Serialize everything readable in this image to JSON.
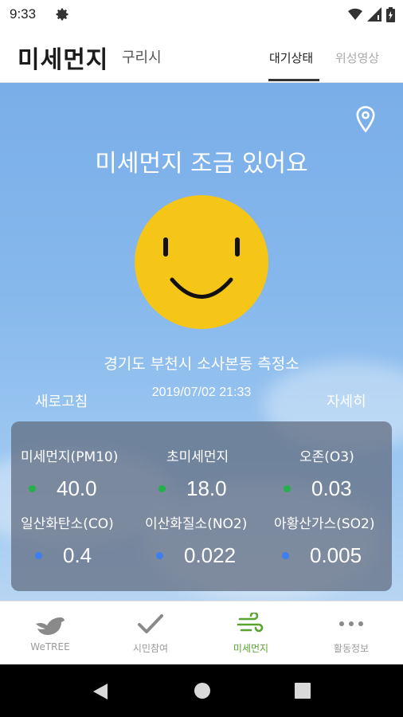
{
  "status_bar": {
    "time": "9:33"
  },
  "header": {
    "logo": "미세먼지",
    "city": "구리시",
    "tabs": [
      {
        "label": "대기상태",
        "active": true
      },
      {
        "label": "위성영상",
        "active": false
      }
    ]
  },
  "main": {
    "headline": "미세먼지 조금 있어요",
    "station": "경기도 부천시 소사본동 측정소",
    "refresh_label": "새로고침",
    "datetime": "2019/07/02 21:33",
    "detail_label": "자세히",
    "measurements": [
      {
        "label": "미세먼지(PM10)",
        "value": "40.0",
        "status_color": "#22b14c"
      },
      {
        "label": "초미세먼지",
        "value": "18.0",
        "status_color": "#22b14c"
      },
      {
        "label": "오존(O3)",
        "value": "0.03",
        "status_color": "#22b14c"
      },
      {
        "label": "일산화탄소(CO)",
        "value": "0.4",
        "status_color": "#3d7ff0"
      },
      {
        "label": "이산화질소(NO2)",
        "value": "0.022",
        "status_color": "#3d7ff0"
      },
      {
        "label": "아황산가스(SO2)",
        "value": "0.005",
        "status_color": "#3d7ff0"
      }
    ]
  },
  "bottom_nav": [
    {
      "label": "WeTREE",
      "icon": "bird-icon",
      "active": false
    },
    {
      "label": "시민참여",
      "icon": "check-icon",
      "active": false
    },
    {
      "label": "미세먼지",
      "icon": "wind-icon",
      "active": true
    },
    {
      "label": "활동정보",
      "icon": "more-dots-icon",
      "active": false
    }
  ],
  "colors": {
    "accent_green": "#5aa532",
    "smiley_yellow": "#f5c518",
    "good_dot": "#22b14c",
    "normal_dot": "#3d7ff0"
  }
}
